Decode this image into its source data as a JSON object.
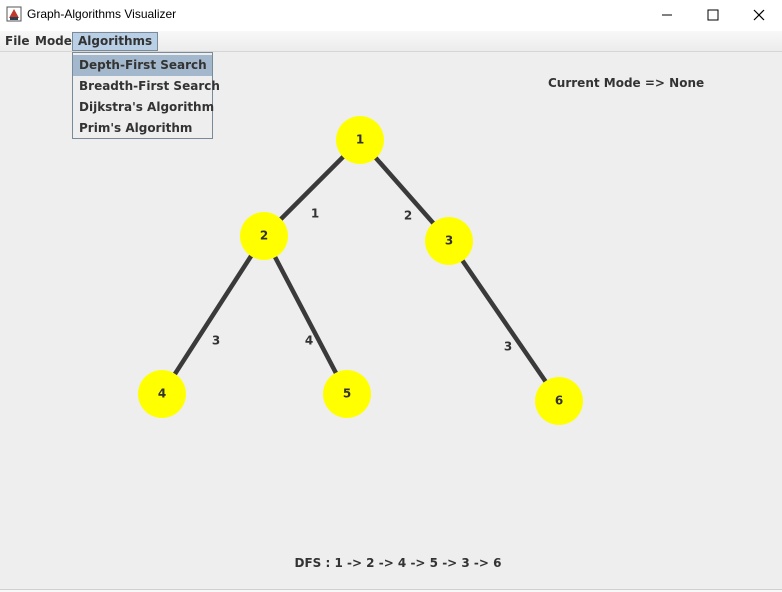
{
  "window": {
    "title": "Graph-Algorithms Visualizer",
    "minimize_icon": "minimize-icon",
    "maximize_icon": "maximize-icon",
    "close_icon": "close-icon"
  },
  "menubar": {
    "items": [
      {
        "label": "File"
      },
      {
        "label": "Mode"
      },
      {
        "label": "Algorithms"
      }
    ],
    "active": "Algorithms"
  },
  "algorithms_menu": {
    "items": [
      {
        "label": "Depth-First Search",
        "selected": true
      },
      {
        "label": "Breadth-First Search",
        "selected": false
      },
      {
        "label": "Dijkstra's Algorithm",
        "selected": false
      },
      {
        "label": "Prim's Algorithm",
        "selected": false
      }
    ]
  },
  "status": {
    "mode": "Current Mode => None",
    "result": "DFS : 1 -> 2 -> 4 -> 5 -> 3 -> 6"
  },
  "colors": {
    "vertex_fill": "#ffff00",
    "edge": "#3a3a3a",
    "label": "#333333"
  },
  "graph": {
    "vertices": [
      {
        "id": "1"
      },
      {
        "id": "2"
      },
      {
        "id": "3"
      },
      {
        "id": "4"
      },
      {
        "id": "5"
      },
      {
        "id": "6"
      }
    ],
    "edges": [
      {
        "from": "1",
        "to": "2",
        "weight": "1"
      },
      {
        "from": "1",
        "to": "3",
        "weight": "2"
      },
      {
        "from": "2",
        "to": "4",
        "weight": "3"
      },
      {
        "from": "2",
        "to": "5",
        "weight": "4"
      },
      {
        "from": "3",
        "to": "6",
        "weight": "3"
      }
    ]
  }
}
